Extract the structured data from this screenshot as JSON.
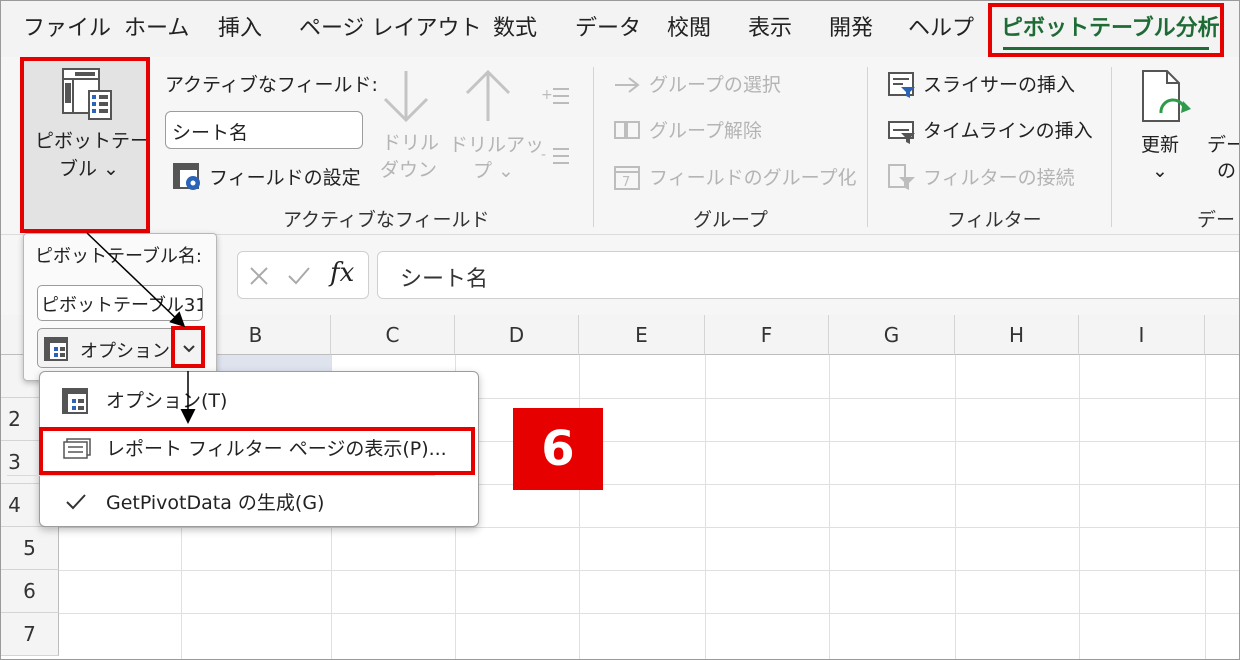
{
  "tabs": [
    {
      "label": "ファイル",
      "active": false
    },
    {
      "label": "ホーム",
      "active": false
    },
    {
      "label": "挿入",
      "active": false
    },
    {
      "label": "ページ レイアウト",
      "active": false
    },
    {
      "label": "数式",
      "active": false
    },
    {
      "label": "データ",
      "active": false
    },
    {
      "label": "校閲",
      "active": false
    },
    {
      "label": "表示",
      "active": false
    },
    {
      "label": "開発",
      "active": false
    },
    {
      "label": "ヘルプ",
      "active": false
    },
    {
      "label": "ピボットテーブル分析",
      "active": true
    }
  ],
  "ribbon": {
    "pivottable_line1": "ピボットテー",
    "pivottable_line2": "ブル ⌄",
    "active_field_label": "アクティブなフィールド:",
    "active_field_value": "シート名",
    "field_settings": "フィールドの設定",
    "drill_down_line1": "ドリル",
    "drill_down_line2": "ダウン",
    "drill_up_line1": "ドリルアッ",
    "drill_up_line2": "プ ⌄",
    "group_selection": "グループの選択",
    "ungroup": "グループ解除",
    "group_field": "フィールドのグループ化",
    "insert_slicer": "スライサーの挿入",
    "insert_timeline": "タイムラインの挿入",
    "filter_connections": "フィルターの接続",
    "refresh": "更新",
    "refresh_arrow": "⌄",
    "datasource_line1": "デー",
    "datasource_line2": "の",
    "group_active_field": "アクティブなフィールド",
    "group_group": "グループ",
    "group_filter": "フィルター",
    "group_data": "デー"
  },
  "formula_bar": {
    "fx": "fx",
    "content": "シート名"
  },
  "pivot_popup": {
    "name_label": "ピボットテーブル名:",
    "name_value": "ピボットテーブル31",
    "options_label": "オプション"
  },
  "menu": {
    "items": [
      {
        "label": "オプション(T)"
      },
      {
        "label": "レポート フィルター ページの表示(P)..."
      },
      {
        "label": "GetPivotData の生成(G)"
      }
    ]
  },
  "grid": {
    "columns": [
      "B",
      "C",
      "D",
      "E",
      "F",
      "G",
      "H",
      "I"
    ],
    "rows": [
      "2",
      "3",
      "4",
      "5",
      "6",
      "7"
    ]
  },
  "step_badge": "6",
  "colors": {
    "accent_green": "#1f6b36",
    "highlight_red": "#e60000"
  }
}
